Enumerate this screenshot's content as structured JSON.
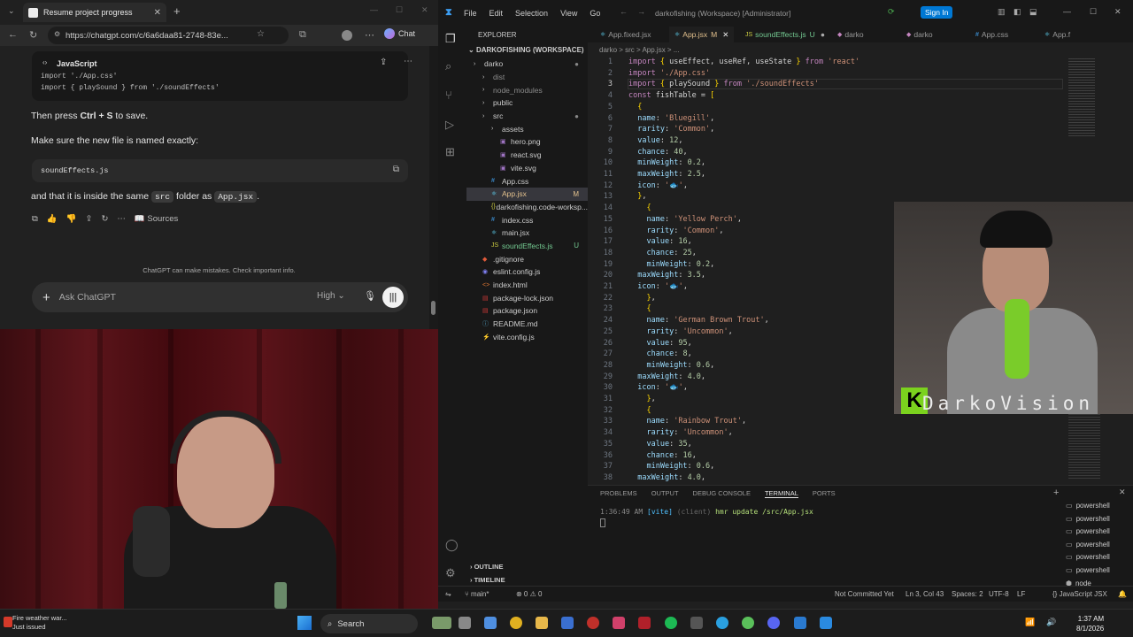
{
  "browser": {
    "tab_title": "Resume project progress",
    "url": "https://chatgpt.com/c/6a6daa81-2748-83e...",
    "chat_button": "Chat"
  },
  "chatgpt": {
    "code_lang": "JavaScript",
    "code_lines": [
      "import './App.css'",
      "import { playSound } from './soundEffects'"
    ],
    "instruction_pre": "Then press ",
    "instruction_keys": "Ctrl + S",
    "instruction_post": " to save.",
    "make_sure": "Make sure the new file is named exactly:",
    "filename": "soundEffects.js",
    "inside_pre": "and that it is inside the same ",
    "inside_folder": "src",
    "inside_mid": " folder as ",
    "inside_file": "App.jsx",
    "inside_post": ".",
    "sources_label": "Sources",
    "disclaimer": "ChatGPT can make mistakes. Check important info.",
    "input_placeholder": "Ask ChatGPT",
    "model_level": "High"
  },
  "vscode": {
    "menu": [
      "File",
      "Edit",
      "Selection",
      "View",
      "Go"
    ],
    "workspace_title": "darkofishing (Workspace) [Administrator]",
    "signin": "Sign In",
    "explorer_title": "EXPLORER",
    "workspace_name": "DARKOFISHING (WORKSPACE)",
    "tree": [
      {
        "label": "darko",
        "indent": 8,
        "icon": "chevron",
        "color": "#cccccc",
        "badge": "●",
        "badge_color": "#888"
      },
      {
        "label": "dist",
        "indent": 18,
        "icon": "chevron",
        "color": "#8b8b8b"
      },
      {
        "label": "node_modules",
        "indent": 18,
        "icon": "chevron",
        "color": "#8b8b8b"
      },
      {
        "label": "public",
        "indent": 18,
        "icon": "chevron",
        "color": "#cccccc"
      },
      {
        "label": "src",
        "indent": 18,
        "icon": "chevron",
        "color": "#cccccc",
        "badge": "●",
        "badge_color": "#888"
      },
      {
        "label": "assets",
        "indent": 28,
        "icon": "chevron",
        "color": "#cccccc"
      },
      {
        "label": "hero.png",
        "indent": 38,
        "icon": "img",
        "color": "#cccccc"
      },
      {
        "label": "react.svg",
        "indent": 38,
        "icon": "img",
        "color": "#cccccc"
      },
      {
        "label": "vite.svg",
        "indent": 38,
        "icon": "img",
        "color": "#cccccc"
      },
      {
        "label": "App.css",
        "indent": 28,
        "icon": "css",
        "color": "#cccccc"
      },
      {
        "label": "App.jsx",
        "indent": 28,
        "icon": "jsx",
        "color": "#e2c08d",
        "badge": "M",
        "badge_color": "#e2c08d",
        "selected": true
      },
      {
        "label": "darkofishing.code-worksp...",
        "indent": 28,
        "icon": "json",
        "color": "#cccccc"
      },
      {
        "label": "index.css",
        "indent": 28,
        "icon": "css",
        "color": "#cccccc"
      },
      {
        "label": "main.jsx",
        "indent": 28,
        "icon": "jsx",
        "color": "#cccccc"
      },
      {
        "label": "soundEffects.js",
        "indent": 28,
        "icon": "js",
        "color": "#73c991",
        "badge": "U",
        "badge_color": "#73c991"
      },
      {
        "label": ".gitignore",
        "indent": 18,
        "icon": "git",
        "color": "#cccccc"
      },
      {
        "label": "eslint.config.js",
        "indent": 18,
        "icon": "eslint",
        "color": "#cccccc"
      },
      {
        "label": "index.html",
        "indent": 18,
        "icon": "html",
        "color": "#cccccc"
      },
      {
        "label": "package-lock.json",
        "indent": 18,
        "icon": "pkg",
        "color": "#cccccc"
      },
      {
        "label": "package.json",
        "indent": 18,
        "icon": "pkg",
        "color": "#cccccc"
      },
      {
        "label": "README.md",
        "indent": 18,
        "icon": "md",
        "color": "#cccccc"
      },
      {
        "label": "vite.config.js",
        "indent": 18,
        "icon": "vite",
        "color": "#cccccc"
      }
    ],
    "outline_label": "OUTLINE",
    "timeline_label": "TIMELINE",
    "tabs": [
      {
        "label": "App.fixed.jsx",
        "flag": ""
      },
      {
        "label": "App.jsx",
        "flag": "M"
      },
      {
        "label": "soundEffects.js",
        "flag": "U"
      },
      {
        "label": "darko",
        "flag": ""
      },
      {
        "label": "darko",
        "flag": ""
      },
      {
        "label": "App.css",
        "flag": ""
      },
      {
        "label": "App.f",
        "flag": ""
      }
    ],
    "breadcrumb": "darko > src > App.jsx > ...",
    "code": [
      "import { useEffect, useRef, useState } from 'react'",
      "import './App.css'",
      "import { playSound } from './soundEffects'",
      "const fishTable = [",
      "  {",
      "  name: 'Bluegill',",
      "  rarity: 'Common',",
      "  value: 12,",
      "  chance: 40,",
      "  minWeight: 0.2,",
      "  maxWeight: 2.5,",
      "  icon: '🐟',",
      "  },",
      "    {",
      "    name: 'Yellow Perch',",
      "    rarity: 'Common',",
      "    value: 16,",
      "    chance: 25,",
      "    minWeight: 0.2,",
      "  maxWeight: 3.5,",
      "  icon: '🐟',",
      "    },",
      "    {",
      "    name: 'German Brown Trout',",
      "    rarity: 'Uncommon',",
      "    value: 95,",
      "    chance: 8,",
      "    minWeight: 0.6,",
      "  maxWeight: 4.0,",
      "  icon: '🐟',",
      "    },",
      "    {",
      "    name: 'Rainbow Trout',",
      "    rarity: 'Uncommon',",
      "    value: 35,",
      "    chance: 16,",
      "    minWeight: 0.6,",
      "  maxWeight: 4.0,"
    ],
    "panel_tabs": [
      "PROBLEMS",
      "OUTPUT",
      "DEBUG CONSOLE",
      "TERMINAL",
      "PORTS"
    ],
    "terminal_time": "1:36:49 AM",
    "terminal_tag": "[vite]",
    "terminal_client": "(client)",
    "terminal_msg": "hmr update /src/App.jsx",
    "shells": [
      "powershell",
      "powershell",
      "powershell",
      "powershell",
      "powershell",
      "powershell",
      "node"
    ],
    "status": {
      "branch": "main*",
      "errors": "⊗ 0 ⚠ 0",
      "commit": "Not Committed Yet",
      "position": "Ln 3, Col 43",
      "spaces": "Spaces: 2",
      "encoding": "UTF-8",
      "eol": "LF",
      "lang": "{} JavaScript JSX"
    }
  },
  "overlay": {
    "brand": "DarkoVision",
    "logo": "K"
  },
  "taskbar": {
    "weather_title": "Fire weather war...",
    "weather_sub": "Just issued",
    "search": "Search",
    "time": "1:37 AM",
    "date": "8/1/2026"
  }
}
